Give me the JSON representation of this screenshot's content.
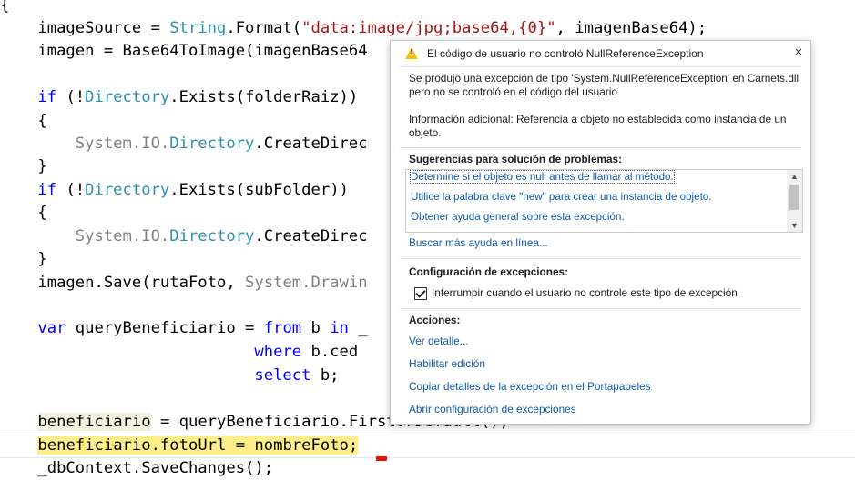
{
  "code": {
    "l1_open": "{",
    "l2_a": "    imageSource = ",
    "l2_type": "String",
    "l2_b": ".Format(",
    "l2_str": "\"data:image/jpg;base64,{0}\"",
    "l2_c": ", imagenBase64);",
    "l3": "    imagen = Base64ToImage(imagenBase64",
    "l4_kw": "    if",
    "l4_a": " (!",
    "l4_type": "Directory",
    "l4_b": ".Exists(folderRaiz))",
    "l5": "    {",
    "l6_gry": "        System.IO.",
    "l6_type": "Directory",
    "l6_b": ".CreateDirec",
    "l7": "    }",
    "l8_kw": "    if",
    "l8_a": " (!",
    "l8_type": "Directory",
    "l8_b": ".Exists(subFolder))",
    "l9": "    {",
    "l10_gry": "        System.IO.",
    "l10_type": "Directory",
    "l10_b": ".CreateDirec",
    "l11": "    }",
    "l12_a": "    imagen.Save(rutaFoto, ",
    "l12_gry": "System.Drawin",
    "l13_kw1": "    var",
    "l13_a": " queryBeneficiario = ",
    "l13_kw2": "from",
    "l13_b": " b ",
    "l13_kw3": "in",
    "l13_c": " _",
    "l14_kw": "                           where",
    "l14_a": " b.ced",
    "l15_kw": "                           select",
    "l15_a": " b;",
    "l16_pre": "    ",
    "l16_hl": "beneficiario",
    "l16_a": " = queryBeneficiario.FirstOrDefault();",
    "l17_pre": "    ",
    "l17_hl": "beneficiario.fotoUrl = nombreFoto;",
    "l18": "    _dbContext.SaveChanges();"
  },
  "dialog": {
    "title": "El código de usuario no controló NullReferenceException",
    "close": "×",
    "message_line1": "Se produjo una excepción de tipo 'System.NullReferenceException' en Carnets.dll",
    "message_line2": "pero no se controló en el código del usuario",
    "info_line1": "Información adicional: Referencia a objeto no establecida como instancia de un",
    "info_line2": "objeto.",
    "suggestions_heading": "Sugerencias para solución de problemas:",
    "suggestions": [
      "Determine si el objeto es null antes de llamar al método.",
      "Utilice la palabra clave \"new\" para crear una instancia de objeto.",
      "Obtener ayuda general sobre esta excepción."
    ],
    "search_more": "Buscar más ayuda en línea...",
    "config_heading": "Configuración de excepciones:",
    "break_checkbox_label": "Interrumpir cuando el usuario no controle este tipo de excepción",
    "actions_heading": "Acciones:",
    "actions": [
      "Ver detalle...",
      "Habilitar edición",
      "Copiar detalles de la excepción en el Portapapeles",
      "Abrir configuración de excepciones"
    ]
  }
}
